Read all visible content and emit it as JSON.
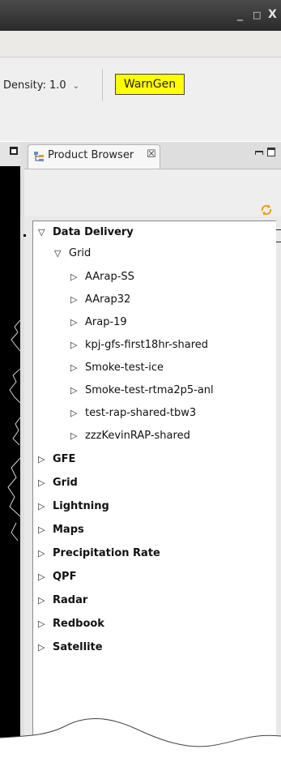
{
  "window": {
    "minimize_glyph": "_",
    "maximize_glyph": "□",
    "close_glyph": "X"
  },
  "toolbar": {
    "density_label": "Density: 1.0",
    "density_caret": "⌄",
    "warngen_label": "WarnGen",
    "warngen_color": "#ffff00"
  },
  "product_browser": {
    "tab_label": "Product Browser",
    "close_glyph": "☒",
    "icon": "product-browser-icon",
    "refresh_icon": "refresh-icon"
  },
  "tree": {
    "data_delivery": {
      "label": "Data Delivery",
      "twisty": "▽"
    },
    "grid_child": {
      "label": "Grid",
      "twisty": "▽"
    },
    "grid_items": [
      {
        "label": "AArap-SS",
        "twisty": "▷"
      },
      {
        "label": "AArap32",
        "twisty": "▷"
      },
      {
        "label": "Arap-19",
        "twisty": "▷"
      },
      {
        "label": "kpj-gfs-first18hr-shared",
        "twisty": "▷"
      },
      {
        "label": "Smoke-test-ice",
        "twisty": "▷"
      },
      {
        "label": "Smoke-test-rtma2p5-anl",
        "twisty": "▷"
      },
      {
        "label": "test-rap-shared-tbw3",
        "twisty": "▷"
      },
      {
        "label": "zzzKevinRAP-shared",
        "twisty": "▷"
      }
    ],
    "top_items": [
      {
        "label": "GFE",
        "twisty": "▷"
      },
      {
        "label": "Grid",
        "twisty": "▷"
      },
      {
        "label": "Lightning",
        "twisty": "▷"
      },
      {
        "label": "Maps",
        "twisty": "▷"
      },
      {
        "label": "Precipitation Rate",
        "twisty": "▷"
      },
      {
        "label": "QPF",
        "twisty": "▷"
      },
      {
        "label": "Radar",
        "twisty": "▷"
      },
      {
        "label": "Redbook",
        "twisty": "▷"
      },
      {
        "label": "Satellite",
        "twisty": "▷"
      }
    ]
  }
}
